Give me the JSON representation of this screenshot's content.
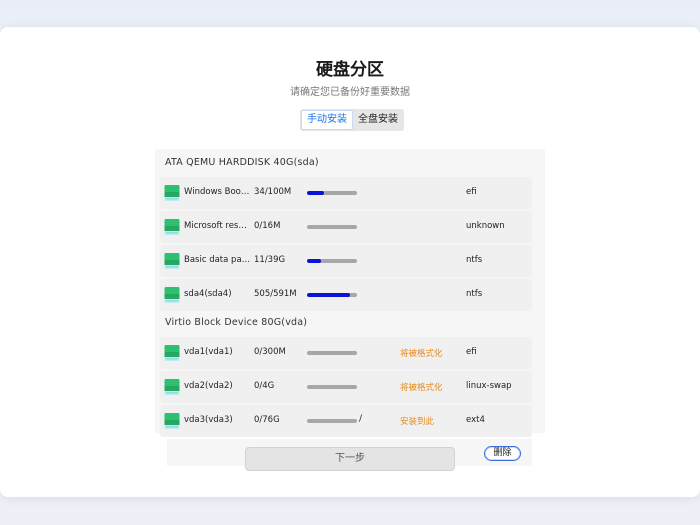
{
  "header": {
    "title": "硬盘分区",
    "subtitle": "请确定您已备份好重要数据"
  },
  "mode_tabs": [
    {
      "label": "手动安装",
      "active": true
    },
    {
      "label": "全盘安装",
      "active": false
    }
  ],
  "disks": [
    {
      "label": "ATA  QEMU  HARDDISK  40G(sda)",
      "partitions": [
        {
          "name": "Windows Boot …",
          "size": "34/100M",
          "usage": 0.34,
          "status": "",
          "fs": "efi",
          "slash": ""
        },
        {
          "name": "Microsoft reserv…",
          "size": "0/16M",
          "usage": 0.0,
          "status": "",
          "fs": "unknown",
          "slash": ""
        },
        {
          "name": "Basic data parti…",
          "size": "11/39G",
          "usage": 0.28,
          "status": "",
          "fs": "ntfs",
          "slash": ""
        },
        {
          "name": "sda4(sda4)",
          "size": "505/591M",
          "usage": 0.85,
          "status": "",
          "fs": "ntfs",
          "slash": ""
        }
      ]
    },
    {
      "label": "Virtio  Block  Device  80G(vda)",
      "partitions": [
        {
          "name": "vda1(vda1)",
          "size": "0/300M",
          "usage": 0.0,
          "status": "将被格式化",
          "fs": "efi",
          "slash": ""
        },
        {
          "name": "vda2(vda2)",
          "size": "0/4G",
          "usage": 0.0,
          "status": "将被格式化",
          "fs": "linux-swap",
          "slash": ""
        },
        {
          "name": "vda3(vda3)",
          "size": "0/76G",
          "usage": 0.0,
          "status": "安装到此",
          "fs": "ext4",
          "slash": "/"
        }
      ]
    }
  ],
  "actions": {
    "delete_label": "删除",
    "next_label": "下一步"
  },
  "colors": {
    "accent": "#1a73e8",
    "usage_fill": "#0a14d9",
    "status_orange": "#e6891c",
    "disk_icon_green": "#2fbf71"
  },
  "icons": {
    "partition": "disk-partition-icon"
  }
}
